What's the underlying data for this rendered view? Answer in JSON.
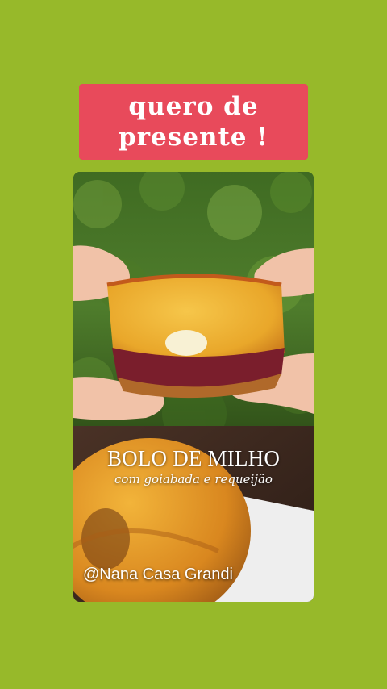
{
  "banner": {
    "line1": "quero de",
    "line2": "presente !"
  },
  "photo": {
    "overlay_title": "BOLO DE MILHO",
    "overlay_subtitle": "com goiabada e requeijão",
    "watermark": "@Nana Casa Grandi"
  },
  "colors": {
    "background": "#97b92a",
    "banner": "#e84a5b",
    "text": "#ffffff"
  }
}
